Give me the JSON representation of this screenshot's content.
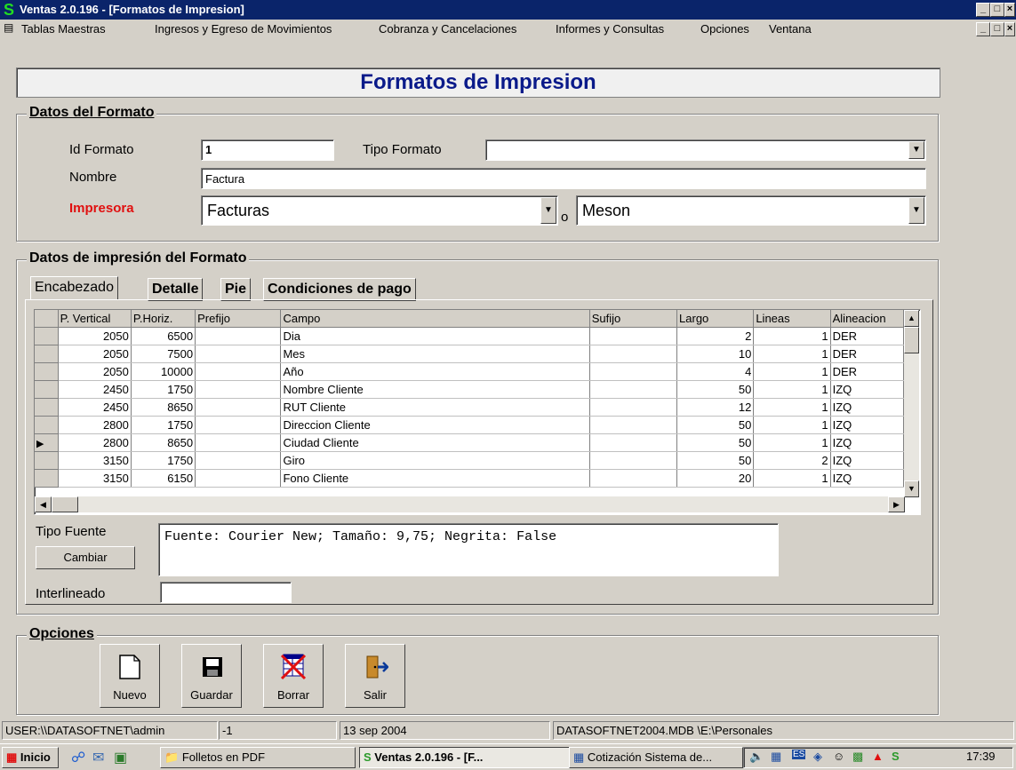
{
  "window": {
    "title": "Ventas 2.0.196 - [Formatos de Impresion]"
  },
  "menu": [
    "Tablas Maestras",
    "Ingresos y Egreso de Movimientos",
    "Cobranza y Cancelaciones",
    "Informes y Consultas",
    "Opciones",
    "Ventana"
  ],
  "form": {
    "title": "Formatos de Impresion",
    "group_format": "Datos del Formato",
    "id_label": "Id Formato",
    "id_value": "1",
    "tipo_label": "Tipo Formato",
    "tipo_value": "",
    "nombre_label": "Nombre",
    "nombre_value": "Factura",
    "impresora_label": "Impresora",
    "impresora_value": "Facturas",
    "o_label": "o",
    "impresora2_value": "Meson"
  },
  "print": {
    "group_label": "Datos de impresión del Formato",
    "tabs": [
      "Encabezado",
      "Detalle",
      "Pie",
      "Condiciones de pago"
    ],
    "columns": [
      "P. Vertical",
      "P.Horiz.",
      "Prefijo",
      "Campo",
      "Sufijo",
      "Largo",
      "Lineas",
      "Alineacion"
    ],
    "rows": [
      {
        "pv": "2050",
        "ph": "6500",
        "prefijo": "",
        "campo": "Dia",
        "sufijo": "",
        "largo": "2",
        "lineas": "1",
        "alin": "DER"
      },
      {
        "pv": "2050",
        "ph": "7500",
        "prefijo": "",
        "campo": "Mes",
        "sufijo": "",
        "largo": "10",
        "lineas": "1",
        "alin": "DER"
      },
      {
        "pv": "2050",
        "ph": "10000",
        "prefijo": "",
        "campo": "Año",
        "sufijo": "",
        "largo": "4",
        "lineas": "1",
        "alin": "DER"
      },
      {
        "pv": "2450",
        "ph": "1750",
        "prefijo": "",
        "campo": "Nombre Cliente",
        "sufijo": "",
        "largo": "50",
        "lineas": "1",
        "alin": "IZQ"
      },
      {
        "pv": "2450",
        "ph": "8650",
        "prefijo": "",
        "campo": "RUT Cliente",
        "sufijo": "",
        "largo": "12",
        "lineas": "1",
        "alin": "IZQ"
      },
      {
        "pv": "2800",
        "ph": "1750",
        "prefijo": "",
        "campo": "Direccion Cliente",
        "sufijo": "",
        "largo": "50",
        "lineas": "1",
        "alin": "IZQ"
      },
      {
        "pv": "2800",
        "ph": "8650",
        "prefijo": "",
        "campo": "Ciudad Cliente",
        "sufijo": "",
        "largo": "50",
        "lineas": "1",
        "alin": "IZQ"
      },
      {
        "pv": "3150",
        "ph": "1750",
        "prefijo": "",
        "campo": "Giro",
        "sufijo": "",
        "largo": "50",
        "lineas": "2",
        "alin": "IZQ"
      },
      {
        "pv": "3150",
        "ph": "6150",
        "prefijo": "",
        "campo": "Fono Cliente",
        "sufijo": "",
        "largo": "20",
        "lineas": "1",
        "alin": "IZQ"
      }
    ],
    "current_row": 6,
    "fuente_label": "Tipo Fuente",
    "fuente_value": "Fuente: Courier New; Tamaño: 9,75; Negrita: False",
    "cambiar_label": "Cambiar",
    "interlineado_label": "Interlineado",
    "interlineado_value": ""
  },
  "options": {
    "group_label": "Opciones",
    "buttons": [
      {
        "label": "Nuevo",
        "icon": "new-document-icon"
      },
      {
        "label": "Guardar",
        "icon": "save-disk-icon"
      },
      {
        "label": "Borrar",
        "icon": "delete-table-icon"
      },
      {
        "label": "Salir",
        "icon": "exit-door-icon"
      }
    ]
  },
  "statusbar": {
    "user": "USER:\\\\DATASOFTNET\\admin",
    "code": "-1",
    "date": "13 sep 2004",
    "db": "DATASOFTNET2004.MDB \\E:\\Personales"
  },
  "taskbar": {
    "start": "Inicio",
    "items": [
      "Folletos en PDF",
      "Ventas 2.0.196 - [F...",
      "Cotización Sistema de..."
    ],
    "clock": "17:39"
  }
}
